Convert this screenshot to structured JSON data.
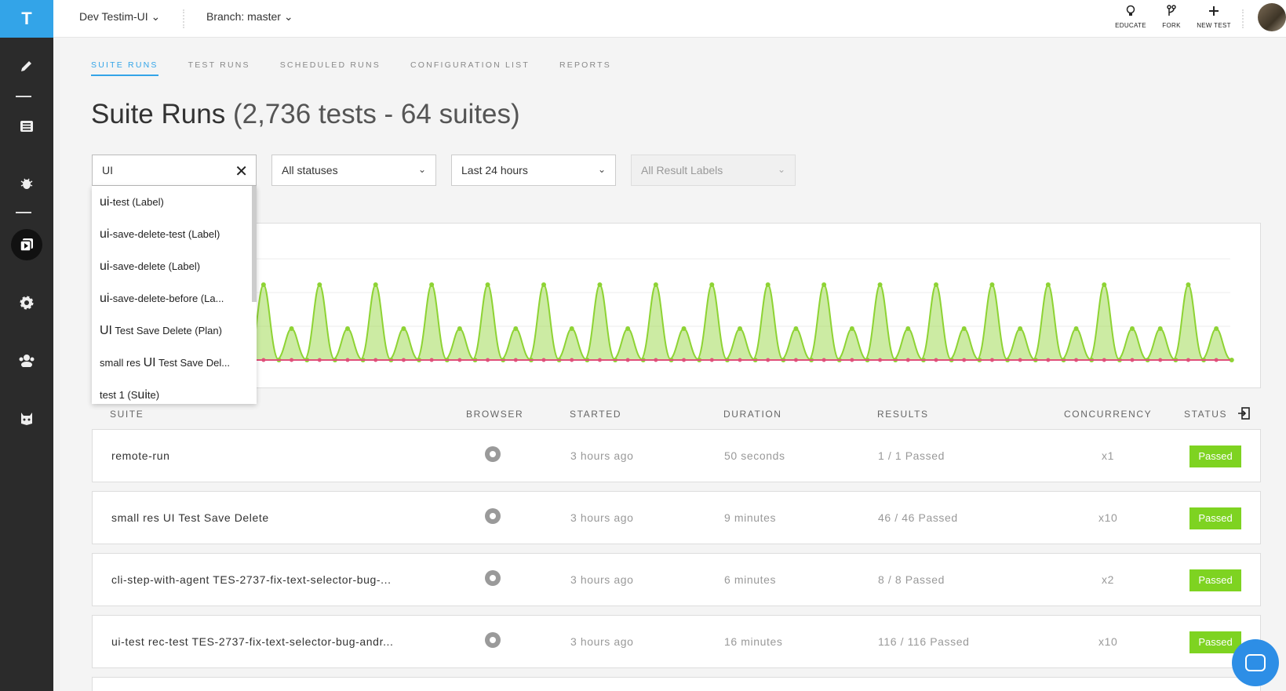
{
  "app": {
    "logo": "T"
  },
  "topbar": {
    "project": "Dev Testim-UI ⌄",
    "branch": "Branch: master ⌄",
    "actions": [
      {
        "icon": "lightbulb-icon",
        "label": "EDUCATE"
      },
      {
        "icon": "fork-icon",
        "label": "FORK"
      },
      {
        "icon": "plus-icon",
        "label": "NEW TEST"
      }
    ]
  },
  "sidebar": {
    "items": [
      {
        "icon": "pencil-icon"
      },
      {
        "icon": "list-icon"
      },
      {
        "icon": "bug-icon"
      },
      {
        "icon": "runs-icon",
        "active": true
      },
      {
        "icon": "gear-icon"
      },
      {
        "icon": "team-icon"
      },
      {
        "icon": "mask-icon"
      }
    ]
  },
  "tabs": [
    "SUITE RUNS",
    "TEST RUNS",
    "SCHEDULED RUNS",
    "CONFIGURATION LIST",
    "REPORTS"
  ],
  "page": {
    "title": "Suite Runs",
    "subtitle": "(2,736 tests - 64 suites)"
  },
  "filters": {
    "search_value": "UI",
    "status": "All statuses",
    "time": "Last 24 hours",
    "labels": "All Result Labels"
  },
  "suggestions": [
    {
      "match": "ui",
      "rest": "-test (Label)"
    },
    {
      "match": "ui",
      "rest": "-save-delete-test (Label)"
    },
    {
      "match": "ui",
      "rest": "-save-delete (Label)"
    },
    {
      "match": "ui",
      "rest": "-save-delete-before (La..."
    },
    {
      "match": "UI",
      "rest": " Test Save Delete (Plan)"
    },
    {
      "pre": "small res ",
      "match": "UI",
      "rest": " Test Save Del..."
    },
    {
      "pre": "test 1 (S",
      "match": "ui",
      "rest": "te)"
    }
  ],
  "chart_data": {
    "type": "area",
    "series": [
      {
        "color": "#8ed334"
      },
      {
        "color": "#e0507a"
      }
    ],
    "peaks": [
      "big",
      "small",
      "big",
      "small",
      "big",
      "small",
      "big",
      "small",
      "big",
      "small",
      "big",
      "small",
      "big",
      "small",
      "big",
      "small",
      "big",
      "small",
      "big",
      "small",
      "big",
      "small",
      "big",
      "small",
      "big",
      "small",
      "big",
      "small",
      "big",
      "small",
      "big",
      "small",
      "small",
      "big",
      "small"
    ]
  },
  "table": {
    "headers": {
      "suite": "SUITE",
      "browser": "BROWSER",
      "started": "STARTED",
      "duration": "DURATION",
      "results": "RESULTS",
      "concurrency": "CONCURRENCY",
      "status": "STATUS"
    },
    "rows": [
      {
        "suite": "remote-run",
        "started": "3 hours ago",
        "duration": "50 seconds",
        "results": "1 / 1 Passed",
        "concurrency": "x1",
        "status": "Passed"
      },
      {
        "suite": "small res UI Test Save Delete",
        "started": "3 hours ago",
        "duration": "9 minutes",
        "results": "46 / 46 Passed",
        "concurrency": "x10",
        "status": "Passed"
      },
      {
        "suite": "cli-step-with-agent TES-2737-fix-text-selector-bug-...",
        "started": "3 hours ago",
        "duration": "6 minutes",
        "results": "8 / 8 Passed",
        "concurrency": "x2",
        "status": "Passed"
      },
      {
        "suite": "ui-test rec-test TES-2737-fix-text-selector-bug-andr...",
        "started": "3 hours ago",
        "duration": "16 minutes",
        "results": "116 / 116 Passed",
        "concurrency": "x10",
        "status": "Passed"
      }
    ]
  },
  "colors": {
    "accent": "#33a4e8",
    "passed": "#7ed321",
    "sidebar": "#2b2b2b"
  }
}
